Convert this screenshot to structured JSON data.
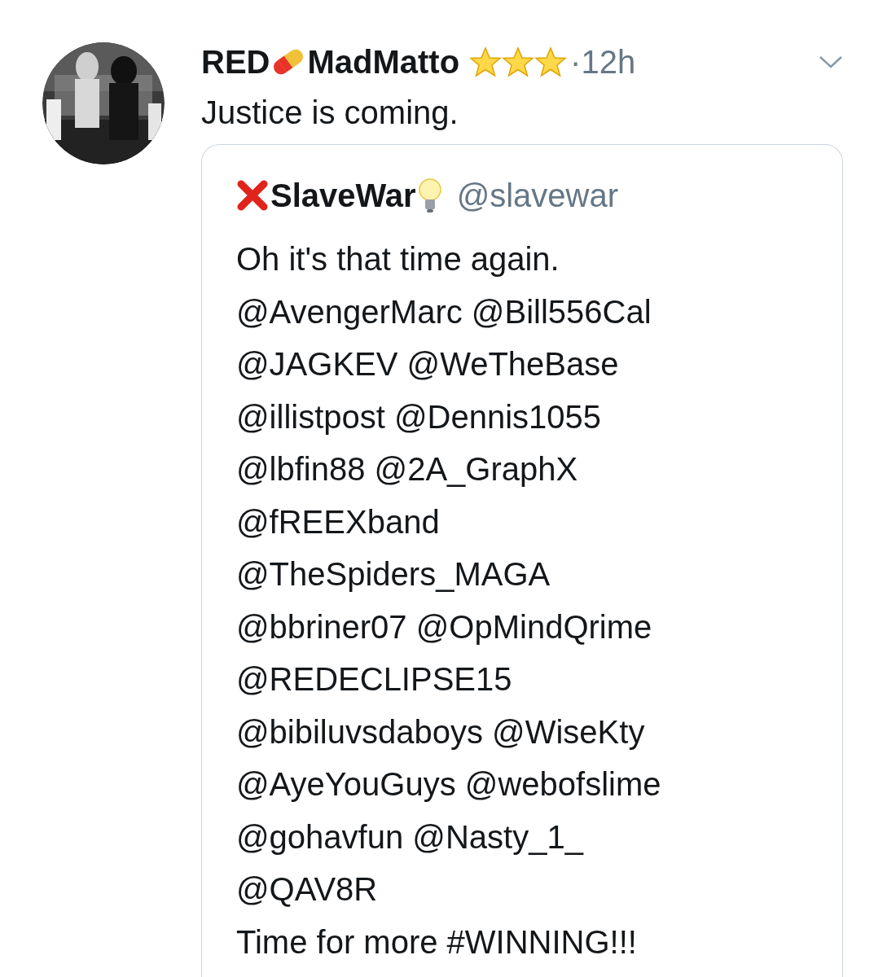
{
  "tweet": {
    "name_parts": [
      "RED",
      "MadMatto"
    ],
    "time": "·12h",
    "text": "Justice is coming."
  },
  "quoted": {
    "name": "SlaveWar",
    "handle": "@slavewar",
    "lines": [
      "Oh it's that time again.",
      "@AvengerMarc @Bill556Cal",
      "@JAGKEV @WeTheBase",
      "@illistpost @Dennis1055",
      "@lbfin88 @2A_GraphX",
      "@fREEXband",
      "@TheSpiders_MAGA",
      "@bbriner07 @OpMindQrime",
      "@REDECLIPSE15",
      "@bibiluvsdaboys @WiseKty",
      "@AyeYouGuys @webofslime",
      "@gohavfun @Nasty_1_",
      "@QAV8R",
      "Time for more #WINNING!!!"
    ]
  }
}
